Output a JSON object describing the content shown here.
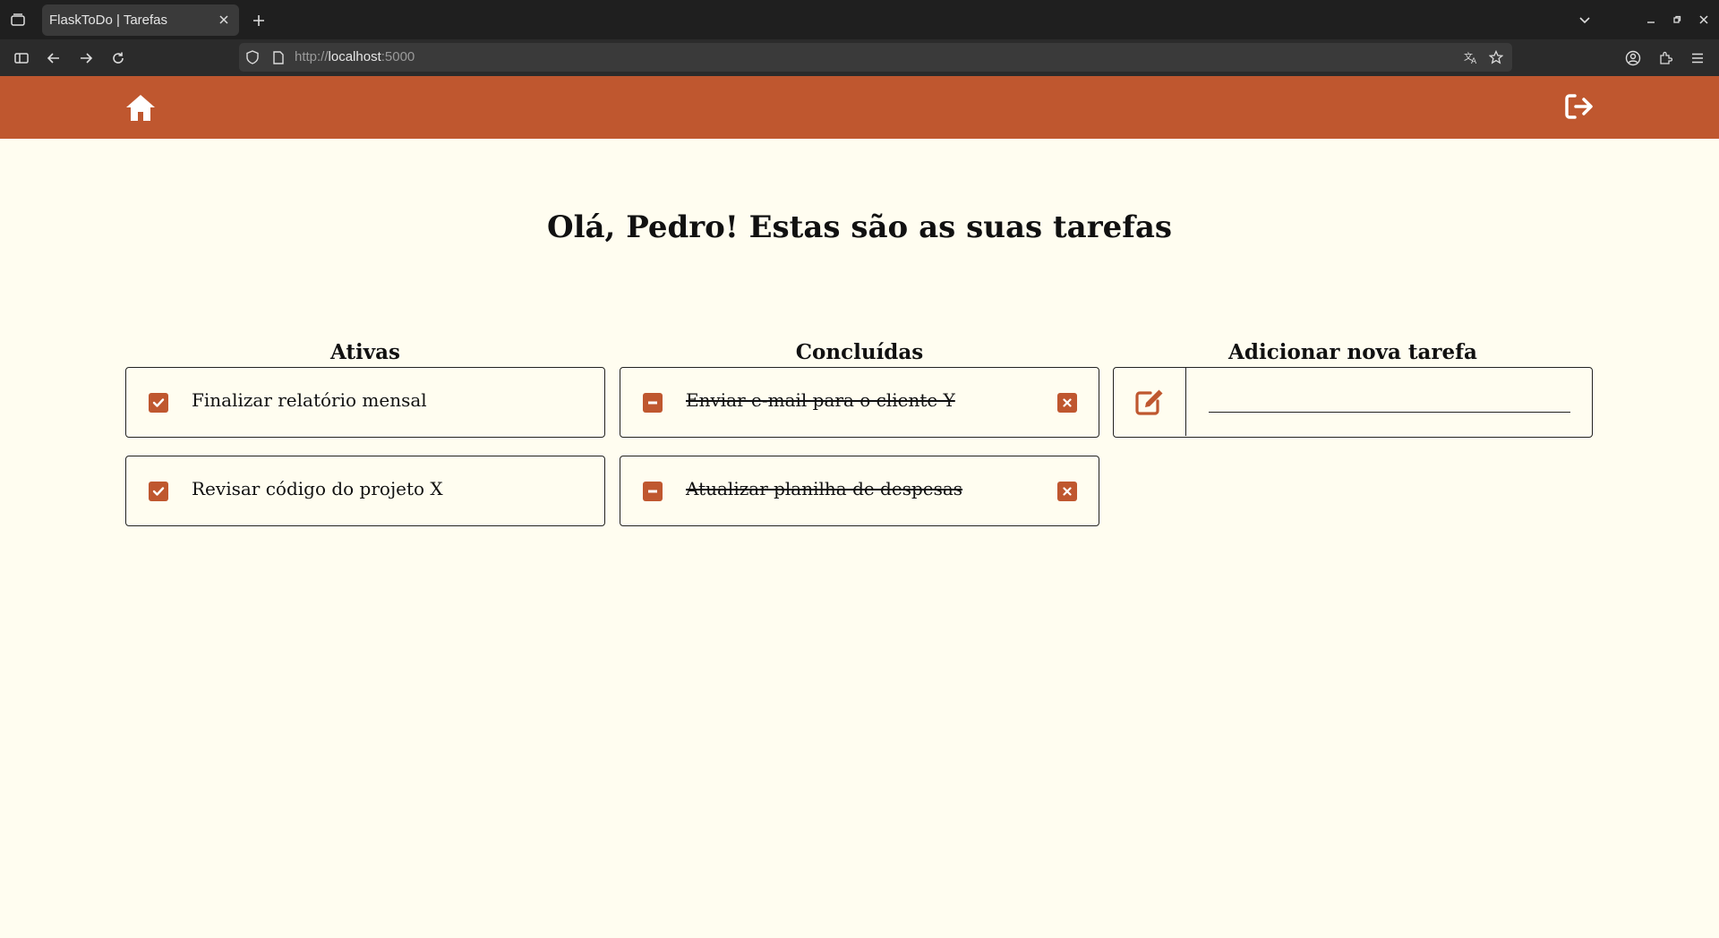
{
  "browser": {
    "tab_title": "FlaskToDo | Tarefas",
    "url_scheme": "http://",
    "url_host": "localhost",
    "url_port": ":5000"
  },
  "header": {
    "home_icon": "home-icon",
    "logout_icon": "logout-icon",
    "background_color": "#bf572f"
  },
  "main": {
    "title": "Olá, Pedro! Estas são as suas tarefas",
    "columns": {
      "active": {
        "title": "Ativas",
        "tasks": [
          {
            "text": "Finalizar relatório mensal"
          },
          {
            "text": "Revisar código do projeto X"
          }
        ]
      },
      "done": {
        "title": "Concluídas",
        "tasks": [
          {
            "text": "Enviar e-mail para o cliente Y"
          },
          {
            "text": "Atualizar planilha de despesas"
          }
        ]
      },
      "add": {
        "title": "Adicionar nova tarefa",
        "input_value": "",
        "input_placeholder": ""
      }
    }
  },
  "colors": {
    "accent": "#bf572f",
    "page_background": "#fffdf0"
  }
}
